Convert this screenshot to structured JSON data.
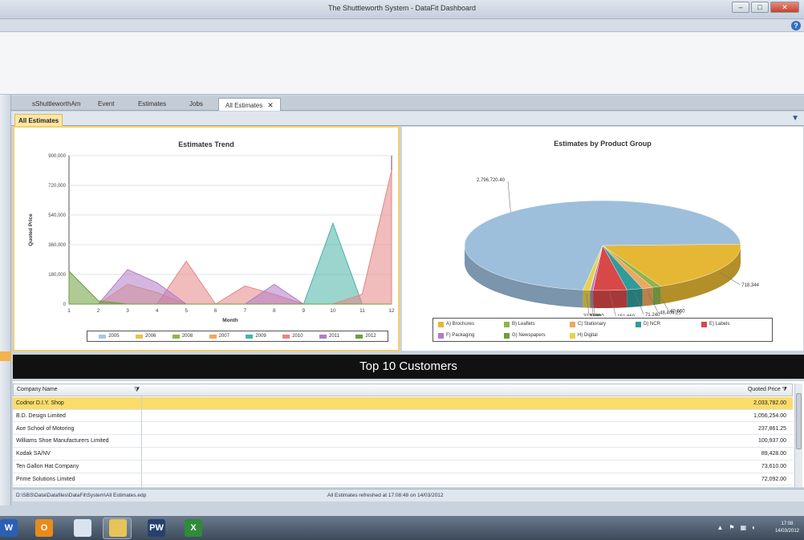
{
  "window": {
    "title": "The Shuttleworth System - DataFit Dashboard"
  },
  "doc_tabs": [
    {
      "label": "sShuttleworthAm"
    },
    {
      "label": "Event"
    },
    {
      "label": "Estimates"
    },
    {
      "label": "Jobs"
    },
    {
      "label": "All Estimates"
    }
  ],
  "sub_tab": "All Estimates",
  "trend_chart": {
    "title": "Estimates Trend",
    "ylabel": "Quoted Price",
    "xlabel": "Month"
  },
  "pie_chart": {
    "title": "Estimates by Product Group"
  },
  "chart_data": [
    {
      "type": "area",
      "title": "Estimates Trend",
      "xlabel": "Month",
      "ylabel": "Quoted Price",
      "x": [
        1,
        2,
        3,
        4,
        5,
        6,
        7,
        8,
        9,
        10,
        11,
        12
      ],
      "ylim": [
        0,
        900000
      ],
      "yticks": [
        "0",
        "180,000",
        "360,000",
        "540,000",
        "720,000",
        "900,000"
      ],
      "grid": true,
      "legend_position": "bottom",
      "series": [
        {
          "name": "2005",
          "color": "#a9c7e0",
          "values": [
            0,
            0,
            0,
            0,
            0,
            0,
            0,
            0,
            0,
            0,
            0,
            0
          ]
        },
        {
          "name": "2006",
          "color": "#e8c14a",
          "values": [
            0,
            0,
            0,
            0,
            0,
            0,
            0,
            0,
            0,
            0,
            0,
            0
          ]
        },
        {
          "name": "2008",
          "color": "#8fb548",
          "values": [
            0,
            0,
            0,
            0,
            0,
            0,
            0,
            0,
            0,
            0,
            0,
            0
          ]
        },
        {
          "name": "2007",
          "color": "#f0a660",
          "values": [
            0,
            0,
            120000,
            70000,
            0,
            0,
            0,
            0,
            0,
            0,
            0,
            0
          ]
        },
        {
          "name": "2009",
          "color": "#49b3a6",
          "values": [
            0,
            0,
            0,
            0,
            0,
            0,
            0,
            0,
            0,
            490000,
            0,
            0
          ]
        },
        {
          "name": "2010",
          "color": "#e58585",
          "values": [
            0,
            0,
            0,
            0,
            260000,
            0,
            110000,
            60000,
            0,
            0,
            60000,
            810000
          ]
        },
        {
          "name": "2011",
          "color": "#b07cc6",
          "values": [
            0,
            0,
            210000,
            130000,
            0,
            0,
            0,
            120000,
            0,
            0,
            0,
            0
          ]
        },
        {
          "name": "2012",
          "color": "#6e9e3c",
          "values": [
            200000,
            20000,
            0,
            0,
            0,
            0,
            0,
            0,
            0,
            0,
            0,
            0
          ]
        }
      ]
    },
    {
      "type": "pie",
      "title": "Estimates by Product Group",
      "legend_position": "bottom",
      "slices": [
        {
          "label": "A) Brochures",
          "value": 718344,
          "data_label": "718,344",
          "color": "#e6b735"
        },
        {
          "label": "B) Leaflets",
          "value": 40660,
          "data_label": "40,660",
          "color": "#8fb548"
        },
        {
          "label": "C) Stationary",
          "value": 48404.25,
          "data_label": "48,404.25",
          "color": "#f0a660"
        },
        {
          "label": "D) NCR",
          "value": 71240,
          "data_label": "71,240",
          "color": "#2f9c9a"
        },
        {
          "label": "E) Labels",
          "value": 151660,
          "data_label": "151,660",
          "color": "#d84848"
        },
        {
          "label": "F) Packaging",
          "value": 11980,
          "data_label": "11,980",
          "color": "#b07cc6"
        },
        {
          "label": "G) Newspapers",
          "value": 2295,
          "data_label": "2,295",
          "color": "#6e9e3c"
        },
        {
          "label": "H) Digital",
          "value": 31388,
          "data_label": "31,388",
          "color": "#e8d24a"
        },
        {
          "label": "",
          "value": 2796720.4,
          "data_label": "2,796,720.40",
          "color": "#9dbfdc"
        }
      ]
    }
  ],
  "top10": {
    "title": "Top 10 Customers",
    "columns": [
      "Company Name",
      "Quoted Price"
    ],
    "rows": [
      {
        "name": "Codnor D.I.Y. Shop",
        "price": "2,033,782.00"
      },
      {
        "name": "B.D. Design Limited",
        "price": "1,056,254.00"
      },
      {
        "name": "Ace School of Motoring",
        "price": "237,861.25"
      },
      {
        "name": "Williams Shoe Manufacturers Limited",
        "price": "100,937.00"
      },
      {
        "name": "Kodak SA/NV",
        "price": "89,428.00"
      },
      {
        "name": "Ten Gallon Hat Company",
        "price": "73,610.00"
      },
      {
        "name": "Prime Solutions Limited",
        "price": "72,092.00"
      }
    ]
  },
  "status": {
    "path": "D:\\SBS\\Data\\Datafiles\\DataFit\\System\\All Estimates.edp",
    "message": "All Estimates refreshed at 17:08:48 on 14/03/2012"
  },
  "taskbar": {
    "apps": [
      {
        "name": "word",
        "glyph": "W",
        "color": "#2b5fb4"
      },
      {
        "name": "outlook",
        "glyph": "O",
        "color": "#e88b1a"
      },
      {
        "name": "documents",
        "glyph": "",
        "color": "#d9e4f0"
      },
      {
        "name": "explorer",
        "glyph": "",
        "color": "#e7c35a"
      },
      {
        "name": "pw",
        "glyph": "PW",
        "color": "#28406f"
      },
      {
        "name": "excel",
        "glyph": "X",
        "color": "#2f8a3a"
      }
    ],
    "time": "17:08",
    "date": "14/03/2012"
  }
}
